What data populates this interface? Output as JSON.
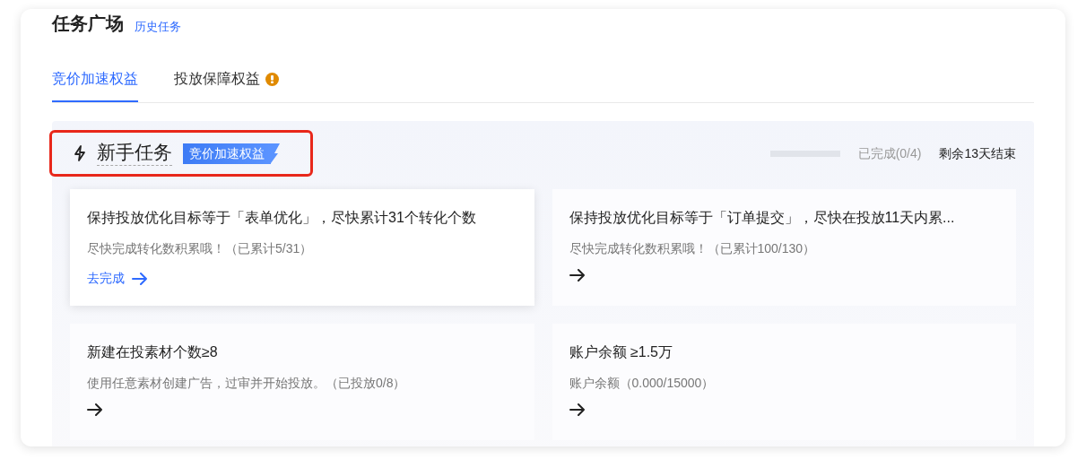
{
  "page": {
    "title": "任务广场",
    "history_link": "历史任务"
  },
  "tabs": [
    {
      "label": "竞价加速权益",
      "selected": true,
      "warning": false
    },
    {
      "label": "投放保障权益",
      "selected": false,
      "warning": true
    }
  ],
  "section": {
    "title": "新手任务",
    "badge": "竞价加速权益",
    "outlined": true,
    "progress": {
      "level": 0,
      "text": "已完成(0/4)"
    },
    "deadline": "剩余13天结束"
  },
  "tasks": [
    {
      "title": "保持投放优化目标等于「表单优化」，尽快累计31个转化个数",
      "description": "尽快完成转化数积累哦！（已累计5/31）",
      "action": "去完成",
      "hovered": true
    },
    {
      "title": "保持投放优化目标等于「订单提交」，尽快在投放11天内累...",
      "description": "尽快完成转化数积累哦！（已累计100/130）",
      "hovered": false
    },
    {
      "title": "新建在投素材个数≥8",
      "description": "使用任意素材创建广告，过审并开始投放。（已投放0/8）",
      "hovered": false
    },
    {
      "title": "账户余额 ≥1.5万",
      "description": "账户余额（0.000/15000）",
      "hovered": false
    }
  ]
}
